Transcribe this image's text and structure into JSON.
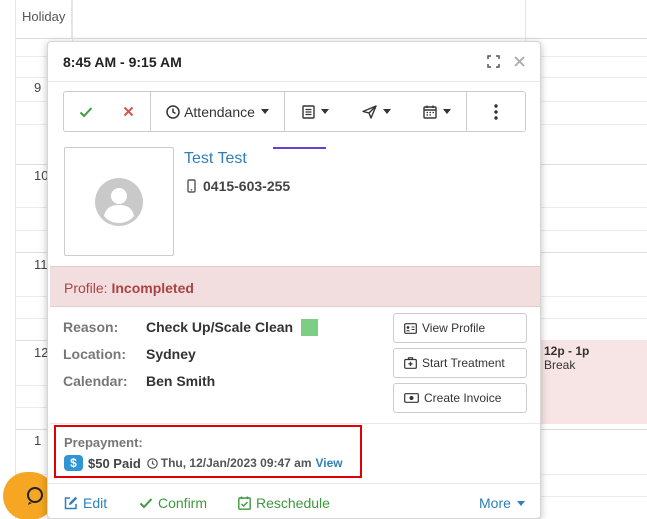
{
  "calendar": {
    "holiday_label": "Holiday",
    "hours": [
      "9",
      "10",
      "11",
      "12",
      "1"
    ],
    "break_event": {
      "time": "12p - 1p",
      "title": "Break"
    }
  },
  "popup": {
    "title": "8:45 AM - 9:15 AM",
    "toolbar": {
      "attendance_label": "Attendance"
    },
    "patient": {
      "name": "Test Test",
      "phone": "0415-603-255"
    },
    "profile": {
      "label": "Profile:",
      "status": "Incompleted"
    },
    "details": {
      "reason_label": "Reason:",
      "reason_value": "Check Up/Scale Clean",
      "location_label": "Location:",
      "location_value": "Sydney",
      "calendar_label": "Calendar:",
      "calendar_value": "Ben Smith"
    },
    "actions": {
      "view_profile": "View Profile",
      "start_treatment": "Start Treatment",
      "create_invoice": "Create Invoice"
    },
    "prepayment": {
      "label": "Prepayment:",
      "amount_text": "$50 Paid",
      "date": "Thu, 12/Jan/2023 09:47 am",
      "view_link": "View"
    },
    "footer": {
      "edit": "Edit",
      "confirm": "Confirm",
      "reschedule": "Reschedule",
      "more": "More"
    }
  },
  "colors": {
    "accent": "#2f7fb8",
    "success": "#3c9a3c",
    "danger": "#a94442",
    "reason_swatch": "#7dcd85",
    "highlight_border": "#e00000",
    "chat_button": "#f5a623"
  }
}
